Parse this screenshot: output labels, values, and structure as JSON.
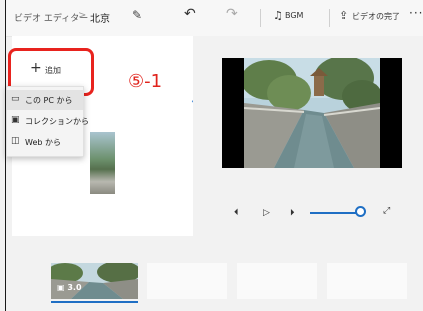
{
  "titlebar": {
    "breadcrumb_root": "ビデオ エディター",
    "breadcrumb_sep": ">",
    "project_name": "北京",
    "bgm_label": "BGM",
    "finish_label": "ビデオの完了",
    "more_glyph": "···"
  },
  "library": {
    "add_label": "追加",
    "menu": [
      {
        "label": "この PC から",
        "icon": "pc-icon"
      },
      {
        "label": "コレクションから",
        "icon": "collection-icon"
      },
      {
        "label": "Web から",
        "icon": "web-icon"
      }
    ]
  },
  "annotation": {
    "step": "⑤-1"
  },
  "storyboard": {
    "clip_duration": "3.0"
  },
  "colors": {
    "accent": "#1f6fc4",
    "highlight": "#e8231e"
  }
}
